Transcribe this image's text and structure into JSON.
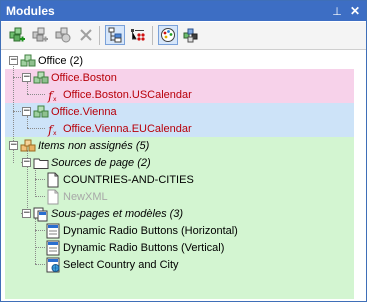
{
  "window": {
    "title": "Modules",
    "pin_glyph": "⊥",
    "close_glyph": "✕"
  },
  "toolbar": {
    "items": [
      {
        "name": "add-module-button",
        "icon": "add-module-icon"
      },
      {
        "name": "add-shared-module-button",
        "icon": "add-shared-module-icon"
      },
      {
        "name": "remove-shared-module-button",
        "icon": "module-settings-icon"
      },
      {
        "name": "delete-button",
        "icon": "delete-x-icon"
      },
      {
        "name": "show-layout-button",
        "icon": "layout-tree-icon",
        "pressed": true
      },
      {
        "name": "show-properties-button",
        "icon": "list-red-dots-icon"
      },
      {
        "name": "color-palette-button",
        "icon": "palette-icon",
        "pressed": true
      },
      {
        "name": "component-settings-button",
        "icon": "cubes-icon"
      }
    ]
  },
  "tree": {
    "colors": {
      "pink": "#f7d2ea",
      "blue": "#cde3f8",
      "green": "#d3f5d1"
    },
    "rows": [
      {
        "id": "office",
        "label": "Office (2)",
        "toggle": "minus",
        "icon": "modules-cluster-icon",
        "style": "normal"
      },
      {
        "id": "office-boston",
        "label": "Office.Boston",
        "toggle": "minus",
        "icon": "module-cluster-icon",
        "style": "red"
      },
      {
        "id": "boston-uscalendar",
        "label": "Office.Boston.USCalendar",
        "icon": "function-icon",
        "style": "red"
      },
      {
        "id": "office-vienna",
        "label": "Office.Vienna",
        "toggle": "minus",
        "icon": "module-cluster-icon",
        "style": "red"
      },
      {
        "id": "vienna-eucalendar",
        "label": "Office.Vienna.EUCalendar",
        "icon": "function-icon",
        "style": "red"
      },
      {
        "id": "unassigned",
        "label": "Items non assignés (5)",
        "toggle": "minus",
        "icon": "unassigned-cubes-icon",
        "style": "italic"
      },
      {
        "id": "page-sources",
        "label": "Sources de page (2)",
        "toggle": "minus",
        "icon": "folder-icon",
        "style": "italic"
      },
      {
        "id": "countries-and-cities",
        "label": "COUNTRIES-AND-CITIES",
        "icon": "page-source-icon",
        "style": "normal"
      },
      {
        "id": "newxml",
        "label": "NewXML",
        "icon": "page-source-icon",
        "style": "grey"
      },
      {
        "id": "subpages-templates",
        "label": "Sous-pages et modèles (3)",
        "toggle": "minus",
        "icon": "pages-stack-icon",
        "style": "italic"
      },
      {
        "id": "radio-horizontal",
        "label": "Dynamic Radio Buttons (Horizontal)",
        "icon": "page-icon",
        "style": "normal"
      },
      {
        "id": "radio-vertical",
        "label": "Dynamic Radio Buttons (Vertical)",
        "icon": "page-icon",
        "style": "normal"
      },
      {
        "id": "select-country-city",
        "label": "Select Country and City",
        "icon": "page-globe-icon",
        "style": "normal"
      }
    ]
  }
}
